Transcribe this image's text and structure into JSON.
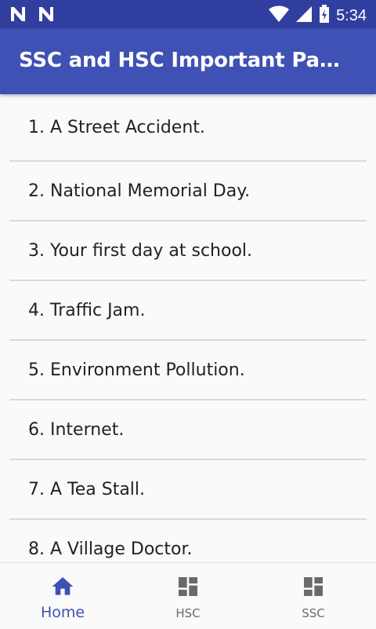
{
  "status_bar": {
    "left_icons": [
      "n-notification-icon",
      "n-notification-icon"
    ],
    "right_icons": [
      "wifi-icon",
      "cell-signal-icon",
      "battery-charging-icon"
    ],
    "time": "5:34"
  },
  "app_bar": {
    "title": "SSC and HSC Important Paragraph"
  },
  "list": {
    "items": [
      {
        "label": "1. A Street Accident."
      },
      {
        "label": "2. National Memorial Day."
      },
      {
        "label": "3. Your first day at school."
      },
      {
        "label": "4. Traffic Jam."
      },
      {
        "label": "5. Environment Pollution."
      },
      {
        "label": "6. Internet."
      },
      {
        "label": "7. A Tea Stall."
      },
      {
        "label": "8. A Village Doctor."
      }
    ]
  },
  "bottom_nav": {
    "items": [
      {
        "label": "Home",
        "icon": "home-icon",
        "active": true
      },
      {
        "label": "HSC",
        "icon": "dashboard-icon",
        "active": false
      },
      {
        "label": "SSC",
        "icon": "dashboard-icon",
        "active": false
      }
    ]
  },
  "colors": {
    "primary": "#3f51b5",
    "primary_dark": "#303f9f",
    "inactive": "#6a6a6a"
  }
}
